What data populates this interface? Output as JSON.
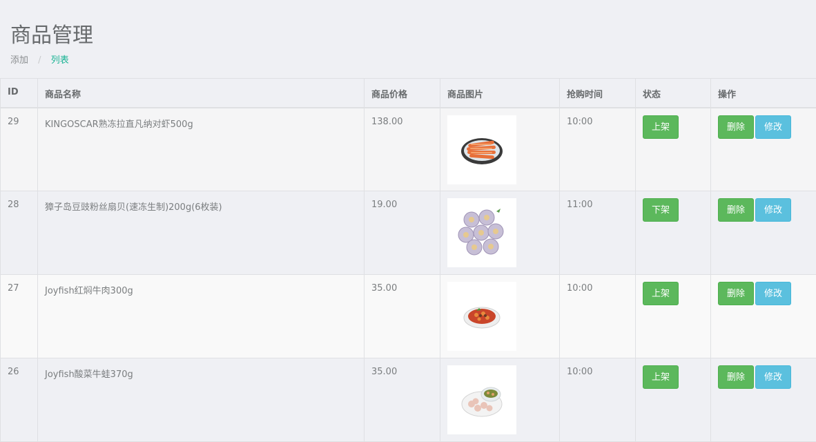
{
  "page": {
    "title": "商品管理"
  },
  "breadcrumb": {
    "add": "添加",
    "separator": "/",
    "list": "列表"
  },
  "table": {
    "headers": {
      "id": "ID",
      "name": "商品名称",
      "price": "商品价格",
      "image": "商品图片",
      "time": "抢购时间",
      "status": "状态",
      "actions": "操作"
    },
    "rows": [
      {
        "id": "29",
        "name": "KINGOSCAR熟冻拉直凡纳对虾500g",
        "price": "138.00",
        "image": "shrimp-plate-image",
        "time": "10:00",
        "status_btn": "上架",
        "delete_btn": "删除",
        "edit_btn": "修改"
      },
      {
        "id": "28",
        "name": "獐子岛豆豉粉丝扇贝(速冻生制)200g(6枚装)",
        "price": "19.00",
        "image": "scallops-image",
        "time": "11:00",
        "status_btn": "下架",
        "delete_btn": "删除",
        "edit_btn": "修改"
      },
      {
        "id": "27",
        "name": "Joyfish红焖牛肉300g",
        "price": "35.00",
        "image": "braised-beef-bowl-image",
        "time": "10:00",
        "status_btn": "上架",
        "delete_btn": "删除",
        "edit_btn": "修改"
      },
      {
        "id": "26",
        "name": "Joyfish酸菜牛蛙370g",
        "price": "35.00",
        "image": "bullfrog-dish-image",
        "time": "10:00",
        "status_btn": "上架",
        "delete_btn": "删除",
        "edit_btn": "修改"
      }
    ]
  },
  "colors": {
    "background": "#eff0f4",
    "accent_link": "#1ab394",
    "button_green": "#5cb85c",
    "button_blue": "#5bc0de"
  }
}
